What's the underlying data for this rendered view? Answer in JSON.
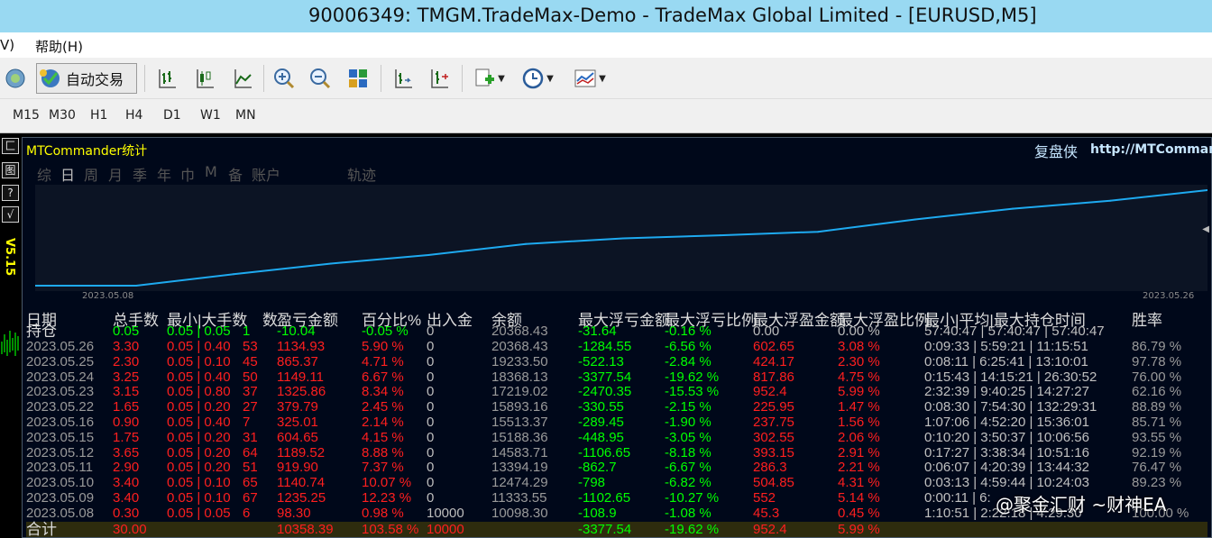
{
  "window": {
    "title": "90006349: TMGM.TradeMax-Demo - TradeMax Global Limited - [EURUSD,M5]"
  },
  "menu": {
    "items": [
      "V)",
      "帮助(H)"
    ]
  },
  "toolbar": {
    "autotrade_label": "自动交易",
    "buttons": [
      "globe-icon",
      "bar-chart-icon",
      "candle-chart-icon",
      "line-chart-icon",
      "zoom-in-icon",
      "zoom-out-icon",
      "tile-icon",
      "chart-shift-icon",
      "autoscroll-icon",
      "new-order-icon",
      "clock-icon",
      "templates-icon"
    ]
  },
  "timeframes": [
    "M15",
    "M30",
    "H1",
    "H4",
    "D1",
    "W1",
    "MN"
  ],
  "side": {
    "buttons": [
      "匚",
      "图",
      "?",
      "√"
    ],
    "version": "V5.15"
  },
  "panel": {
    "title": "MTCommander统计",
    "fupan": "复盘侠",
    "url": "http://MTCommand",
    "tabs": [
      "综",
      "日",
      "周",
      "月",
      "季",
      "年",
      "巾",
      "M",
      "备",
      "账户",
      "轨迹"
    ],
    "active_tab": "日"
  },
  "chart_data": {
    "type": "line",
    "x_start_label": "2023.05.08",
    "x_end_label": "2023.05.26",
    "x": [
      "2023.05.08",
      "2023.05.09",
      "2023.05.10",
      "2023.05.11",
      "2023.05.12",
      "2023.05.15",
      "2023.05.16",
      "2023.05.22",
      "2023.05.23",
      "2023.05.24",
      "2023.05.25",
      "2023.05.26"
    ],
    "values": [
      10098.3,
      11333.55,
      12474.29,
      13394.19,
      14583.71,
      15188.36,
      15513.37,
      15893.16,
      17219.02,
      18368.13,
      19233.5,
      20368.43
    ],
    "color": "#1eaaf0"
  },
  "table": {
    "headers": [
      "日期",
      "持仓",
      "总手数",
      "最小|大手数",
      "数",
      "盈亏金额",
      "百分比%",
      "出入金",
      "余额",
      "最大浮亏金额",
      "最大浮亏比例",
      "最大浮盈金额",
      "最大浮盈比例",
      "最小|平均|最大持仓时间",
      "胜率"
    ],
    "position_row": {
      "total": "0.05",
      "minmax": "0.05 | 0.05",
      "count": "1",
      "pl": "-10.04",
      "pct": "-0.05 %",
      "io": "0",
      "balance": "20368.43",
      "mf": "-31.64",
      "mfp": "-0.16 %",
      "mp": "0.00",
      "mpp": "0.00 %",
      "time": "57:40:47 | 57:40:47 | 57:40:47",
      "win": ""
    },
    "rows": [
      {
        "date": "2023.05.26",
        "total": "3.30",
        "minmax": "0.05 | 0.40",
        "count": "53",
        "pl": "1134.93",
        "pct": "5.90 %",
        "io": "0",
        "balance": "20368.43",
        "mf": "-1284.55",
        "mfp": "-6.56 %",
        "mp": "602.65",
        "mpp": "3.08 %",
        "time": "0:09:33 | 5:59:21 | 11:15:51",
        "win": "86.79 %"
      },
      {
        "date": "2023.05.25",
        "total": "2.30",
        "minmax": "0.05 | 0.10",
        "count": "45",
        "pl": "865.37",
        "pct": "4.71 %",
        "io": "0",
        "balance": "19233.50",
        "mf": "-522.13",
        "mfp": "-2.84 %",
        "mp": "424.17",
        "mpp": "2.30 %",
        "time": "0:08:11 | 6:25:41 | 13:10:01",
        "win": "97.78 %"
      },
      {
        "date": "2023.05.24",
        "total": "3.25",
        "minmax": "0.05 | 0.40",
        "count": "50",
        "pl": "1149.11",
        "pct": "6.67 %",
        "io": "0",
        "balance": "18368.13",
        "mf": "-3377.54",
        "mfp": "-19.62 %",
        "mp": "817.86",
        "mpp": "4.75 %",
        "time": "0:15:43 | 14:15:21 | 26:30:52",
        "win": "76.00 %"
      },
      {
        "date": "2023.05.23",
        "total": "3.15",
        "minmax": "0.05 | 0.80",
        "count": "37",
        "pl": "1325.86",
        "pct": "8.34 %",
        "io": "0",
        "balance": "17219.02",
        "mf": "-2470.35",
        "mfp": "-15.53 %",
        "mp": "952.4",
        "mpp": "5.99 %",
        "time": "2:32:39 | 9:40:25 | 14:27:27",
        "win": "62.16 %"
      },
      {
        "date": "2023.05.22",
        "total": "1.65",
        "minmax": "0.05 | 0.20",
        "count": "27",
        "pl": "379.79",
        "pct": "2.45 %",
        "io": "0",
        "balance": "15893.16",
        "mf": "-330.55",
        "mfp": "-2.15 %",
        "mp": "225.95",
        "mpp": "1.47 %",
        "time": "0:08:30 | 7:54:30 | 132:29:31",
        "win": "88.89 %"
      },
      {
        "date": "2023.05.16",
        "total": "0.90",
        "minmax": "0.05 | 0.40",
        "count": "7",
        "pl": "325.01",
        "pct": "2.14 %",
        "io": "0",
        "balance": "15513.37",
        "mf": "-289.45",
        "mfp": "-1.90 %",
        "mp": "237.75",
        "mpp": "1.56 %",
        "time": "1:07:06 | 4:52:20 | 15:36:01",
        "win": "85.71 %"
      },
      {
        "date": "2023.05.15",
        "total": "1.75",
        "minmax": "0.05 | 0.20",
        "count": "31",
        "pl": "604.65",
        "pct": "4.15 %",
        "io": "0",
        "balance": "15188.36",
        "mf": "-448.95",
        "mfp": "-3.05 %",
        "mp": "302.55",
        "mpp": "2.06 %",
        "time": "0:10:20 | 3:50:37 | 10:06:56",
        "win": "93.55 %"
      },
      {
        "date": "2023.05.12",
        "total": "3.65",
        "minmax": "0.05 | 0.20",
        "count": "64",
        "pl": "1189.52",
        "pct": "8.88 %",
        "io": "0",
        "balance": "14583.71",
        "mf": "-1106.65",
        "mfp": "-8.18 %",
        "mp": "393.15",
        "mpp": "2.91 %",
        "time": "0:17:27 | 3:38:34 | 10:51:16",
        "win": "92.19 %"
      },
      {
        "date": "2023.05.11",
        "total": "2.90",
        "minmax": "0.05 | 0.20",
        "count": "51",
        "pl": "919.90",
        "pct": "7.37 %",
        "io": "0",
        "balance": "13394.19",
        "mf": "-862.7",
        "mfp": "-6.67 %",
        "mp": "286.3",
        "mpp": "2.21 %",
        "time": "0:06:07 | 4:20:39 | 13:44:32",
        "win": "76.47 %"
      },
      {
        "date": "2023.05.10",
        "total": "3.40",
        "minmax": "0.05 | 0.10",
        "count": "65",
        "pl": "1140.74",
        "pct": "10.07 %",
        "io": "0",
        "balance": "12474.29",
        "mf": "-798",
        "mfp": "-6.82 %",
        "mp": "504.85",
        "mpp": "4.31 %",
        "time": "0:03:13 | 4:59:44 | 10:24:03",
        "win": "89.23 %"
      },
      {
        "date": "2023.05.09",
        "total": "3.40",
        "minmax": "0.05 | 0.10",
        "count": "67",
        "pl": "1235.25",
        "pct": "12.23 %",
        "io": "0",
        "balance": "11333.55",
        "mf": "-1102.65",
        "mfp": "-10.27 %",
        "mp": "552",
        "mpp": "5.14 %",
        "time": "0:00:11 | 6:",
        "win": ""
      },
      {
        "date": "2023.05.08",
        "total": "0.30",
        "minmax": "0.05 | 0.05",
        "count": "6",
        "pl": "98.30",
        "pct": "0.98 %",
        "io": "10000",
        "balance": "10098.30",
        "mf": "-108.9",
        "mfp": "-1.08 %",
        "mp": "45.3",
        "mpp": "0.45 %",
        "time": "1:10:51 | 2:22:18 | 4:29:30",
        "win": "100.00 %"
      }
    ],
    "sum_row": {
      "label": "合计",
      "total": "30.00",
      "pl": "10358.39",
      "pct": "103.58 %",
      "io": "10000",
      "mf": "-3377.54",
      "mfp": "-19.62 %",
      "mp": "952.4",
      "mpp": "5.99 %"
    }
  },
  "watermark": "@聚金汇财 ~财神EA"
}
